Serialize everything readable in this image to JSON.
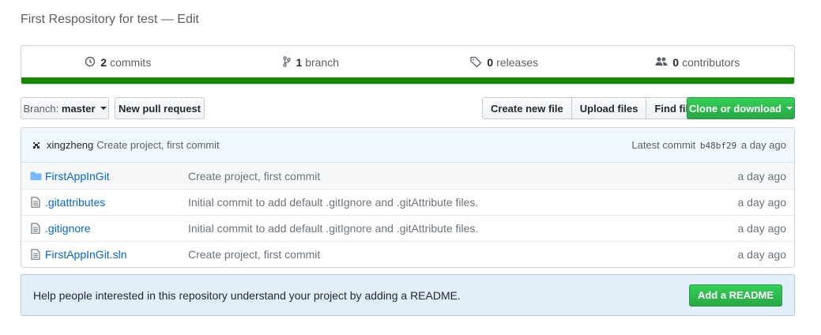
{
  "repo": {
    "description": "First Respository for test — Edit"
  },
  "summary": {
    "commits": {
      "count": "2",
      "label": "commits"
    },
    "branches": {
      "count": "1",
      "label": "branch"
    },
    "releases": {
      "count": "0",
      "label": "releases"
    },
    "contributors": {
      "count": "0",
      "label": "contributors"
    },
    "language_color": "#178600"
  },
  "toolbar": {
    "branch_prefix": "Branch:",
    "branch_name": "master",
    "new_pr": "New pull request",
    "create_file": "Create new file",
    "upload_files": "Upload files",
    "find_file": "Find file",
    "clone": "Clone or download"
  },
  "latest_commit": {
    "author": "xingzheng",
    "message": "Create project, first commit",
    "prefix": "Latest commit",
    "sha": "b48bf29",
    "age": "a day ago"
  },
  "files": [
    {
      "name": "FirstAppInGit",
      "type": "folder",
      "message": "Create project, first commit",
      "age": "a day ago"
    },
    {
      "name": ".gitattributes",
      "type": "file",
      "message": "Initial commit to add default .gitIgnore and .gitAttribute files.",
      "age": "a day ago"
    },
    {
      "name": ".gitignore",
      "type": "file",
      "message": "Initial commit to add default .gitIgnore and .gitAttribute files.",
      "age": "a day ago"
    },
    {
      "name": "FirstAppInGit.sln",
      "type": "file",
      "message": "Create project, first commit",
      "age": "a day ago"
    }
  ],
  "readme_prompt": {
    "text": "Help people interested in this repository understand your project by adding a README.",
    "button": "Add a README"
  },
  "colors": {
    "link": "#0366d6",
    "green_button": "#28a745",
    "folder_icon": "#79b8ff"
  }
}
